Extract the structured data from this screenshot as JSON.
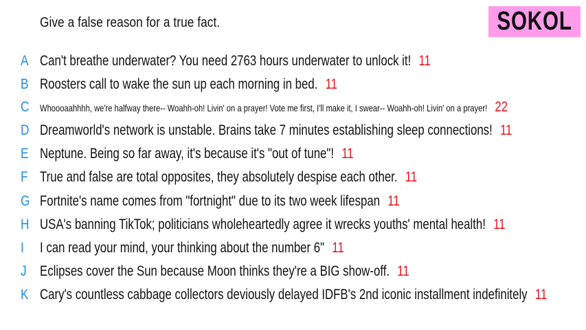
{
  "prompt": "Give a false reason for a true fact.",
  "player": "SOKOL",
  "colors": {
    "badge_bg": "#ff9ce9",
    "letter": "#1e8fe0",
    "score": "#e8141c"
  },
  "answers": [
    {
      "letter": "A",
      "text": "Can't breathe underwater? You need 2763 hours underwater to unlock it!",
      "score": "11"
    },
    {
      "letter": "B",
      "text": "Roosters call to wake the sun up each morning in bed.",
      "score": "11"
    },
    {
      "letter": "C",
      "text": "Whoooaahhhh, we're halfway there-- Woahh-oh! Livin' on a prayer! Vote me first, I'll make it, I swear-- Woahh-oh! Livin' on a prayer!",
      "score": "22"
    },
    {
      "letter": "D",
      "text": "Dreamworld's network is unstable. Brains take 7 minutes establishing sleep connections!",
      "score": "11"
    },
    {
      "letter": "E",
      "text": "Neptune. Being so far away, it's because it's \"out of tune\"!",
      "score": "11"
    },
    {
      "letter": "F",
      "text": "True and false are total opposites, they absolutely despise each other.",
      "score": "11"
    },
    {
      "letter": "G",
      "text": "Fortnite's name comes from \"fortnight\" due to its two week lifespan",
      "score": "11"
    },
    {
      "letter": "H",
      "text": "USA's banning TikTok; politicians wholeheartedly agree it wrecks youths' mental health!",
      "score": "11"
    },
    {
      "letter": "I",
      "text": "I can read your mind, your thinking about the number 6\"",
      "score": "11"
    },
    {
      "letter": "J",
      "text": "Eclipses cover the Sun because Moon thinks they're a BIG show-off.",
      "score": "11"
    },
    {
      "letter": "K",
      "text": "Cary's countless cabbage collectors deviously delayed IDFB's 2nd iconic installment indefinitely",
      "score": "11"
    }
  ]
}
